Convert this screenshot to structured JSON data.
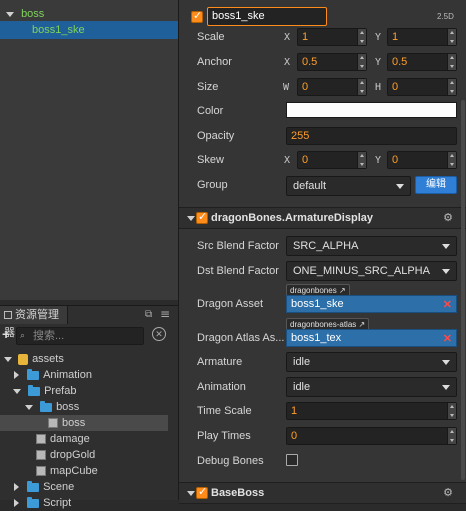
{
  "hierarchy": {
    "items": [
      {
        "label": "boss"
      },
      {
        "label": "boss1_ske"
      }
    ]
  },
  "assets_panel": {
    "tab_label": "资源管理器",
    "search_placeholder": "搜索...",
    "tree": [
      {
        "label": "assets"
      },
      {
        "label": "Animation"
      },
      {
        "label": "Prefab"
      },
      {
        "label": "boss"
      },
      {
        "label": "boss"
      },
      {
        "label": "damage"
      },
      {
        "label": "dropGold"
      },
      {
        "label": "mapCube"
      },
      {
        "label": "Scene"
      },
      {
        "label": "Script"
      }
    ]
  },
  "inspector": {
    "node_name": "boss1_ske",
    "mode_label": "2.5D",
    "scale": {
      "label": "Scale",
      "x_axis": "X",
      "x": "1",
      "y_axis": "Y",
      "y": "1"
    },
    "anchor": {
      "label": "Anchor",
      "x_axis": "X",
      "x": "0.5",
      "y_axis": "Y",
      "y": "0.5"
    },
    "size": {
      "label": "Size",
      "w_axis": "W",
      "w": "0",
      "h_axis": "H",
      "h": "0"
    },
    "color": {
      "label": "Color",
      "value": "#ffffff"
    },
    "opacity": {
      "label": "Opacity",
      "value": "255"
    },
    "skew": {
      "label": "Skew",
      "x_axis": "X",
      "x": "0",
      "y_axis": "Y",
      "y": "0"
    },
    "group": {
      "label": "Group",
      "value": "default",
      "edit_button": "编辑"
    },
    "dragon_section": {
      "title": "dragonBones.ArmatureDisplay",
      "src_blend": {
        "label": "Src Blend Factor",
        "value": "SRC_ALPHA"
      },
      "dst_blend": {
        "label": "Dst Blend Factor",
        "value": "ONE_MINUS_SRC_ALPHA"
      },
      "dragon_asset": {
        "label": "Dragon Asset",
        "tag": "dragonbones",
        "value": "boss1_ske"
      },
      "dragon_atlas": {
        "label": "Dragon Atlas As...",
        "tag": "dragonbones-atlas",
        "value": "boss1_tex"
      },
      "armature": {
        "label": "Armature",
        "value": "idle"
      },
      "animation": {
        "label": "Animation",
        "value": "idle"
      },
      "time_scale": {
        "label": "Time Scale",
        "value": "1"
      },
      "play_times": {
        "label": "Play Times",
        "value": "0"
      },
      "debug_bones": {
        "label": "Debug Bones",
        "checked": false
      }
    },
    "baseboss_section": {
      "title": "BaseBoss"
    }
  },
  "colors": {
    "accent": "#ff8b1a",
    "selection": "#1f5f9a",
    "asset_field": "#2d6fa8",
    "tree_green": "#7fd35b"
  }
}
